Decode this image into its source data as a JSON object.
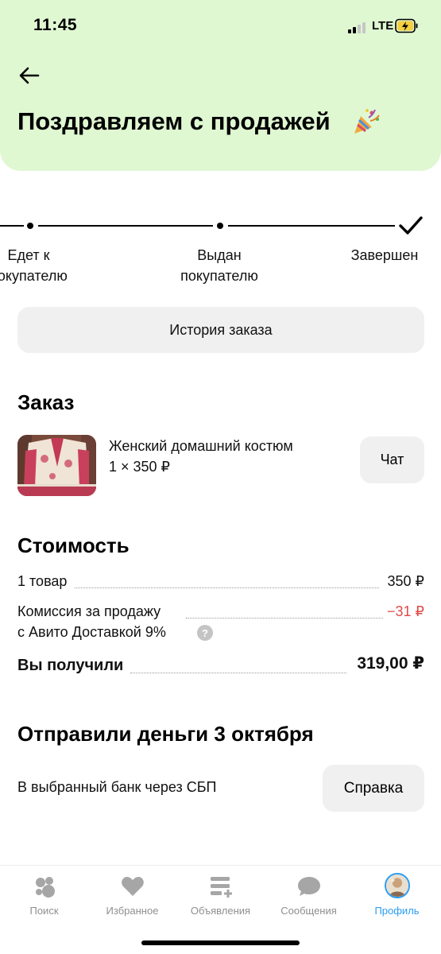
{
  "status_bar": {
    "time": "11:45",
    "network": "LTE"
  },
  "header": {
    "title": "Поздравляем с продажей"
  },
  "tracker": {
    "steps": [
      {
        "label_line1": "Едет к",
        "label_line2": "покупателю"
      },
      {
        "label_line1": "Выдан",
        "label_line2": "покупателю"
      },
      {
        "label_line1": "Завершен",
        "label_line2": ""
      }
    ]
  },
  "order_history_button": "История заказа",
  "order": {
    "title": "Заказ",
    "product_name": "Женский домашний костюм",
    "product_qty": "1 × 350 ₽",
    "chat_button": "Чат"
  },
  "cost": {
    "title": "Стоимость",
    "items_label": "1 товар",
    "items_value": "350 ₽",
    "commission_line1": "Комиссия за продажу",
    "commission_line2": "с Авито Доставкой 9%",
    "commission_value": "−31 ₽",
    "help_symbol": "?",
    "received_label": "Вы получили",
    "received_value": "319,00 ₽"
  },
  "payout": {
    "title": "Отправили деньги 3 октября",
    "method": "В выбранный банк через СБП",
    "help_button": "Справка"
  },
  "tabbar": {
    "items": [
      {
        "label": "Поиск",
        "icon": "search-icon"
      },
      {
        "label": "Избранное",
        "icon": "heart-icon"
      },
      {
        "label": "Объявления",
        "icon": "listings-icon"
      },
      {
        "label": "Сообщения",
        "icon": "chat-bubble-icon"
      },
      {
        "label": "Профиль",
        "icon": "avatar",
        "active": true
      }
    ]
  },
  "colors": {
    "header_bg": "#dff8d2",
    "accent_blue": "#2a9df4",
    "negative_red": "#e24a4a",
    "button_bg": "#f0f0f0"
  }
}
